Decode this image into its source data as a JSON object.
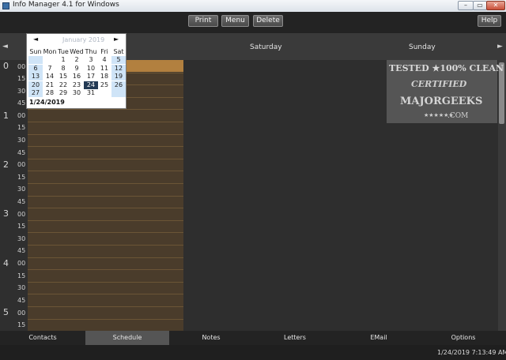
{
  "window": {
    "title": "Info Manager 4.1 for Windows",
    "min_glyph": "–",
    "max_glyph": "▭",
    "close_glyph": "✕"
  },
  "toolbar": {
    "print": "Print",
    "menu": "Menu",
    "delete": "Delete",
    "help": "Help"
  },
  "schedule": {
    "nav_prev": "◄",
    "nav_next": "►",
    "days": [
      "Saturday",
      "Sunday"
    ],
    "hours": [
      "0",
      "1",
      "2",
      "3",
      "4",
      "5"
    ],
    "minutes": [
      "00",
      "15",
      "30",
      "45"
    ]
  },
  "calendar": {
    "month_label": "January 2019",
    "prev": "◄",
    "next": "►",
    "weekdays": [
      "Sun",
      "Mon",
      "Tue",
      "Wed",
      "Thu",
      "Fri",
      "Sat"
    ],
    "weeks": [
      [
        "",
        "",
        "1",
        "2",
        "3",
        "4",
        "5"
      ],
      [
        "6",
        "7",
        "8",
        "9",
        "10",
        "11",
        "12"
      ],
      [
        "13",
        "14",
        "15",
        "16",
        "17",
        "18",
        "19"
      ],
      [
        "20",
        "21",
        "22",
        "23",
        "24",
        "25",
        "26"
      ],
      [
        "27",
        "28",
        "29",
        "30",
        "31",
        "",
        ""
      ]
    ],
    "today": "24",
    "selected_date": "1/24/2019"
  },
  "watermark": {
    "line1": "TESTED ★100% CLEAN",
    "line2": "CERTIFIED",
    "line3": "MAJORGEEKS",
    "line4": ".COM",
    "stars": "★★★★★★"
  },
  "tabs": [
    "Contacts",
    "Schedule",
    "Notes",
    "Letters",
    "EMail",
    "Options"
  ],
  "status": {
    "datetime": "1/24/2019 7:13:49 AM"
  },
  "colors": {
    "accent_slot": "#b2803f",
    "day_column": "#4a3c2b",
    "today_highlight": "#233a55"
  }
}
